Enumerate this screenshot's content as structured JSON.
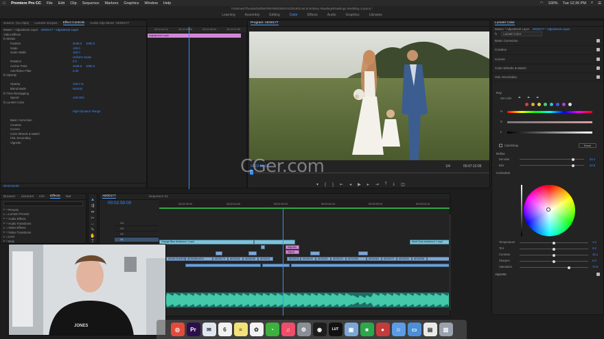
{
  "menubar": {
    "app_name": "Premiere Pro CC",
    "items": [
      "File",
      "Edit",
      "Clip",
      "Sequence",
      "Markers",
      "Graphics",
      "Window",
      "Help"
    ],
    "time": "Tue 12:26 PM",
    "percent": "100%"
  },
  "titlebar": {
    "path": "/Volumes/Thunderbolt/WORK/WEDDINGS/2018/Scott & Brittany Rawlings/Rawlings Wedding 3.prproj *"
  },
  "workspaces": [
    "Learning",
    "Assembly",
    "Editing",
    "Color",
    "Effects",
    "Audio",
    "Graphics",
    "Libraries"
  ],
  "workspace_active": "Color",
  "source_panel": {
    "tabs": [
      "Source: (no clips)",
      "Lumetri Scopes",
      "Effect Controls",
      "Audio Clip Mixer: AE00177"
    ],
    "active_tab": "Effect Controls",
    "master_label": "Master * Adjustment Layer",
    "sequence_label": "AE00177 * Adjustment Layer",
    "timecodes": [
      "00:02:44:12",
      "00:02:45:08",
      "00:02:46:04",
      "00:02:47:00"
    ],
    "clip_label": "Adjustment Layer",
    "video_effects_label": "Video Effects",
    "rows": [
      {
        "label": "fx  Motion",
        "level": 0
      },
      {
        "label": "Position",
        "level": 1,
        "v1": "2048.0",
        "v2": "1080.0"
      },
      {
        "label": "Scale",
        "level": 1,
        "v1": "100.0"
      },
      {
        "label": "Scale Width",
        "level": 1,
        "v1": "100.0"
      },
      {
        "label": "",
        "level": 1,
        "v1": "Uniform Scale"
      },
      {
        "label": "Rotation",
        "level": 1,
        "v1": "0.0"
      },
      {
        "label": "Anchor Point",
        "level": 1,
        "v1": "2048.0",
        "v2": "1080.0"
      },
      {
        "label": "Anti-flicker Filter",
        "level": 1,
        "v1": "0.00"
      },
      {
        "label": "fx  Opacity",
        "level": 0
      },
      {
        "label": "",
        "level": 1
      },
      {
        "label": "Opacity",
        "level": 1,
        "v1": "100.0 %"
      },
      {
        "label": "Blend Mode",
        "level": 1,
        "v1": "Normal"
      },
      {
        "label": "fx  Time Remapping",
        "level": 0
      },
      {
        "label": "Speed",
        "level": 1,
        "v1": "100.00%"
      },
      {
        "label": "fx  Lumetri Color",
        "level": 0
      },
      {
        "label": "",
        "level": 1
      },
      {
        "label": "",
        "level": 1,
        "v1": "High Dynamic Range"
      },
      {
        "label": "",
        "level": 1
      },
      {
        "label": "Basic Correction",
        "level": 1
      },
      {
        "label": "Creative",
        "level": 1
      },
      {
        "label": "Curves",
        "level": 1
      },
      {
        "label": "Color Wheels & Match",
        "level": 1
      },
      {
        "label": "HSL Secondary",
        "level": 1
      },
      {
        "label": "Vignette",
        "level": 1
      }
    ],
    "bottom_timecode": "00:02:50:00"
  },
  "program": {
    "title": "Program: AE00177",
    "timecode_current": "00:02:50:00",
    "fit": "1/4",
    "timecode_total": "00:07:12:09"
  },
  "watermark": "CGer.com",
  "project": {
    "tabs": [
      "Browser",
      "Libraries",
      "Info",
      "Effects",
      "Mar"
    ],
    "active_tab": "Effects",
    "items": [
      "Presets",
      "Lumetri Presets",
      "Audio Effects",
      "Audio Transitions",
      "Video Effects",
      "Video Transitions",
      "Lear",
      "Disk"
    ]
  },
  "timeline": {
    "tabs": [
      "AE00177",
      "Sequence 01"
    ],
    "timecode": "00:02:50:00",
    "ruler": [
      "00:02:39:20",
      "00:02:44:20",
      "00:02:49:19",
      "00:02:54:19",
      "00:02:59:19",
      "00:03:04:19"
    ],
    "track_labels": [
      "V4",
      "V3",
      "V2",
      "V1",
      "A1"
    ],
    "clips": {
      "c1": "Orange Blue Ambience 1.mp4",
      "c2": "Multi Color Ambience 1.mp4",
      "p1": "Adjustm",
      "p2": "Adjust",
      "v1": "AE00178.MOV",
      "v2": "AE00256.MOV",
      "v3": "AE00179",
      "v4": "AE00182",
      "v5": "AE00189",
      "v6": "AE00191",
      "v7": "AE00191.MOV",
      "v8": "AE00194",
      "v9": "AE00201",
      "v10": "AE00223",
      "v11": "AE00256",
      "v12": "AE00264",
      "v13": "AE00270",
      "v14": "AE00294",
      "v15": "AE00298"
    }
  },
  "lumetri": {
    "tabs": [
      "Lumetri Color"
    ],
    "master_label": "Master * Adjustment Layer",
    "sequence_label": "AE00177 * Adjustment Layer",
    "effect_name": "Lumetri Color",
    "sections": [
      "Basic Correction",
      "Creative",
      "Curves",
      "Color Wheels & Match",
      "HSL Secondary"
    ],
    "key_label": "Key",
    "set_color_label": "Set color",
    "hsl": [
      "H",
      "S",
      "L"
    ],
    "color_gray": "Color/Gray",
    "reset_btn": "Reset",
    "refine_label": "Refine",
    "denoise_label": "Denoise",
    "denoise_value": "34.1",
    "blur_label": "Blur",
    "blur_value": "22.6",
    "correction_label": "Correction",
    "sliders": [
      {
        "label": "Temperature",
        "value": "1.0"
      },
      {
        "label": "Tint",
        "value": "0.0"
      },
      {
        "label": "Contrast",
        "value": "16.1"
      },
      {
        "label": "Sharpen",
        "value": "0.0"
      },
      {
        "label": "Saturation",
        "value": "72.6"
      }
    ],
    "vignette_label": "Vignette"
  },
  "webcam": {
    "shirt_text": "JONES"
  },
  "dock": {
    "icons": [
      {
        "name": "chrome-icon",
        "color": "#e14b3b",
        "glyph": "◎"
      },
      {
        "name": "premiere-icon",
        "color": "#2a0f4a",
        "glyph": "Pr"
      },
      {
        "name": "mail-icon",
        "color": "#dfe6ef",
        "glyph": "✉"
      },
      {
        "name": "calendar-icon",
        "color": "#f2f2f2",
        "glyph": "6"
      },
      {
        "name": "notes-icon",
        "color": "#f5e17a",
        "glyph": "≡"
      },
      {
        "name": "photos-icon",
        "color": "#f2f2f2",
        "glyph": "✿"
      },
      {
        "name": "messages-icon",
        "color": "#3eb03e",
        "glyph": "◔"
      },
      {
        "name": "music-icon",
        "color": "#f04d6b",
        "glyph": "♫"
      },
      {
        "name": "preferences-icon",
        "color": "#8a8f97",
        "glyph": "⚙"
      },
      {
        "name": "spotify-icon",
        "color": "#1d1d1d",
        "glyph": "◉"
      },
      {
        "name": "lut-icon",
        "color": "#111111",
        "glyph": "LUT"
      },
      {
        "name": "preview-icon",
        "color": "#7aa7d6",
        "glyph": "▣"
      },
      {
        "name": "facetime-icon",
        "color": "#2aa84a",
        "glyph": "■"
      },
      {
        "name": "photo-booth-icon",
        "color": "#c53a3a",
        "glyph": "●"
      },
      {
        "name": "finder-icon",
        "color": "#5c9be5",
        "glyph": "☺"
      },
      {
        "name": "folder-icon",
        "color": "#4a8fd7",
        "glyph": "▭"
      },
      {
        "name": "document-icon",
        "color": "#eaeaea",
        "glyph": "▤"
      },
      {
        "name": "trash-icon",
        "color": "#9aa3ad",
        "glyph": "▥"
      }
    ]
  },
  "colors": {
    "accent": "#4a9eff",
    "playhead": "#3d8eff",
    "audio": "#36b89a"
  }
}
